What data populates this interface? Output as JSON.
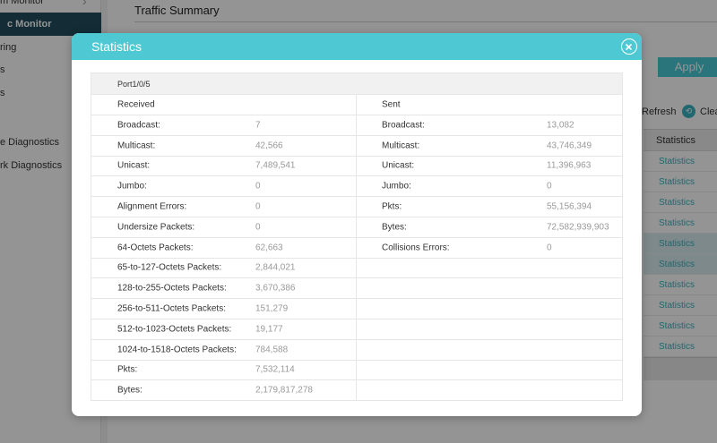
{
  "sidebar": {
    "items": [
      {
        "label": "m Monitor"
      },
      {
        "label": "c Monitor"
      },
      {
        "label": "ring"
      },
      {
        "label": "s"
      },
      {
        "label": "s"
      },
      {
        "label": "e Diagnostics"
      },
      {
        "label": "rk Diagnostics"
      }
    ]
  },
  "main": {
    "title": "Traffic Summary",
    "apply_label": "Apply",
    "refresh_label": "Refresh",
    "clear_label": "Clea",
    "statistics_header": "Statistics",
    "statistics_link": "Statistics"
  },
  "modal": {
    "title": "Statistics",
    "port": "Port1/0/5",
    "received_header": "Received",
    "sent_header": "Sent",
    "received": [
      {
        "label": "Broadcast:",
        "value": "7"
      },
      {
        "label": "Multicast:",
        "value": "42,566"
      },
      {
        "label": "Unicast:",
        "value": "7,489,541"
      },
      {
        "label": "Jumbo:",
        "value": "0"
      },
      {
        "label": "Alignment Errors:",
        "value": "0"
      },
      {
        "label": "Undersize Packets:",
        "value": "0"
      },
      {
        "label": "64-Octets Packets:",
        "value": "62,663"
      },
      {
        "label": "65-to-127-Octets Packets:",
        "value": "2,844,021"
      },
      {
        "label": "128-to-255-Octets Packets:",
        "value": "3,670,386"
      },
      {
        "label": "256-to-511-Octets Packets:",
        "value": "151,279"
      },
      {
        "label": "512-to-1023-Octets Packets:",
        "value": "19,177"
      },
      {
        "label": "1024-to-1518-Octets Packets:",
        "value": "784,588"
      },
      {
        "label": "Pkts:",
        "value": "7,532,114"
      },
      {
        "label": "Bytes:",
        "value": "2,179,817,278"
      }
    ],
    "sent": [
      {
        "label": "Broadcast:",
        "value": "13,082"
      },
      {
        "label": "Multicast:",
        "value": "43,746,349"
      },
      {
        "label": "Unicast:",
        "value": "11,396,963"
      },
      {
        "label": "Jumbo:",
        "value": "0"
      },
      {
        "label": "Pkts:",
        "value": "55,156,394"
      },
      {
        "label": "Bytes:",
        "value": "72,582,939,903"
      },
      {
        "label": "Collisions Errors:",
        "value": "0"
      }
    ]
  },
  "colors": {
    "accent": "#4ec9d4",
    "sidebar_active": "#214d5d",
    "link": "#3ab1c0"
  }
}
